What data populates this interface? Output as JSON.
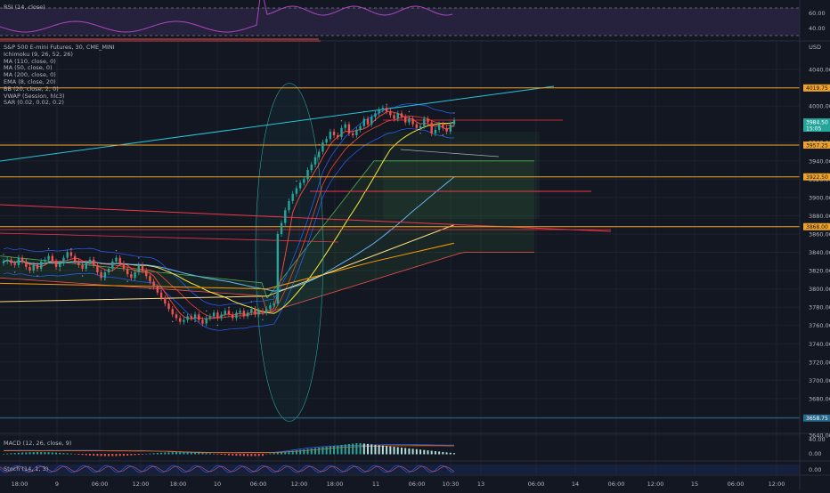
{
  "colors": {
    "background": "#131722",
    "grid": "#1e222d",
    "bull": "#26a69a",
    "bear": "#ef5350",
    "hline": "#f0a32a",
    "rsi_band": "#7e57c2",
    "trend_teal": "#26c6da",
    "trend_red": "#f23645",
    "vwap": "#c2185b",
    "bb": "#2962ff",
    "ma_yellow": "#ffeb3b",
    "ma_blue": "#64b5f6",
    "ma_orange": "#ff9800",
    "ema_red": "#f44336",
    "sar": "#9598a1"
  },
  "legend": {
    "symbol": "S&P 500 E-mini Futures, 30, CME_MINI",
    "items": [
      "Ichimoku (9, 26, 52, 26)",
      "MA (110, close, 0)",
      "MA (50, close, 0)",
      "MA (200, close, 0)",
      "EMA (8, close, 20)",
      "BB (20, close, 2, 0)",
      "VWAP (Session, hlc3)",
      "SAR (0.02, 0.02, 0.2)"
    ]
  },
  "panes": {
    "rsi": {
      "title": "RSI (14, close)",
      "ticks": [
        "60.00",
        "40.00"
      ]
    },
    "macd": {
      "title": "MACD (12, 26, close, 9)",
      "ticks": [
        "40.00",
        "0.00"
      ]
    },
    "stoch": {
      "title": "Stoch (14, 1, 3)",
      "ticks": [
        "0.00"
      ]
    }
  },
  "axis": {
    "currency": "USD",
    "price_ticks": [
      "4040.00",
      "4000.00",
      "3960.00",
      "3940.00",
      "3920.00",
      "3900.00",
      "3880.00",
      "3860.00",
      "3840.00",
      "3820.00",
      "3800.00",
      "3780.00",
      "3760.00",
      "3740.00",
      "3720.00",
      "3700.00",
      "3680.00",
      "3660.00",
      "3640.00"
    ],
    "time_ticks": [
      "18:00",
      "9",
      "06:00",
      "12:00",
      "18:00",
      "10",
      "06:00",
      "12:00",
      "18:00",
      "11",
      "06:00",
      "10:30",
      "13",
      "06:00",
      "14",
      "06:00",
      "12:00",
      "15",
      "06:00",
      "12:00"
    ]
  },
  "price_labels": [
    {
      "text": "4019.75",
      "color": "#f0a32a",
      "fg": "#131722"
    },
    {
      "text": "3984.50",
      "color": "#26a69a",
      "fg": "#ffffff"
    },
    {
      "text": "15:05",
      "color": "#26a69a",
      "fg": "#ffffff"
    },
    {
      "text": "3957.25",
      "color": "#f0a32a",
      "fg": "#131722"
    },
    {
      "text": "3922.50",
      "color": "#f0a32a",
      "fg": "#131722"
    },
    {
      "text": "3868.00",
      "color": "#f0a32a",
      "fg": "#131722"
    },
    {
      "text": "3658.75",
      "color": "#2a6a8e",
      "fg": "#ffffff"
    }
  ],
  "chart_data": {
    "type": "candlestick",
    "title": "S&P 500 E-mini Futures, 30, CME_MINI",
    "ylabel": "USD",
    "ylim": [
      3640,
      4060
    ],
    "horizontal_levels": [
      4019.75,
      3957.25,
      3922.5,
      3868.0,
      3658.75
    ],
    "last_price": 3984.5,
    "closes": [
      3830,
      3832,
      3828,
      3826,
      3834,
      3830,
      3824,
      3820,
      3826,
      3822,
      3830,
      3832,
      3836,
      3830,
      3824,
      3828,
      3834,
      3840,
      3836,
      3830,
      3826,
      3822,
      3828,
      3832,
      3826,
      3818,
      3812,
      3818,
      3822,
      3830,
      3834,
      3828,
      3822,
      3816,
      3812,
      3818,
      3826,
      3820,
      3814,
      3808,
      3802,
      3796,
      3790,
      3784,
      3778,
      3772,
      3768,
      3764,
      3766,
      3770,
      3768,
      3772,
      3766,
      3762,
      3768,
      3770,
      3774,
      3768,
      3772,
      3776,
      3772,
      3768,
      3774,
      3776,
      3770,
      3774,
      3778,
      3772,
      3776,
      3774,
      3778,
      3782,
      3784,
      3860,
      3872,
      3886,
      3896,
      3904,
      3910,
      3916,
      3920,
      3930,
      3936,
      3944,
      3950,
      3960,
      3964,
      3972,
      3968,
      3966,
      3976,
      3980,
      3970,
      3968,
      3974,
      3978,
      3986,
      3980,
      3988,
      3992,
      3996,
      3998,
      3994,
      3990,
      3986,
      3992,
      3988,
      3982,
      3986,
      3980,
      3976,
      3978,
      3986,
      3982,
      3970,
      3974,
      3980,
      3976,
      3972,
      3980,
      3984.5
    ]
  }
}
